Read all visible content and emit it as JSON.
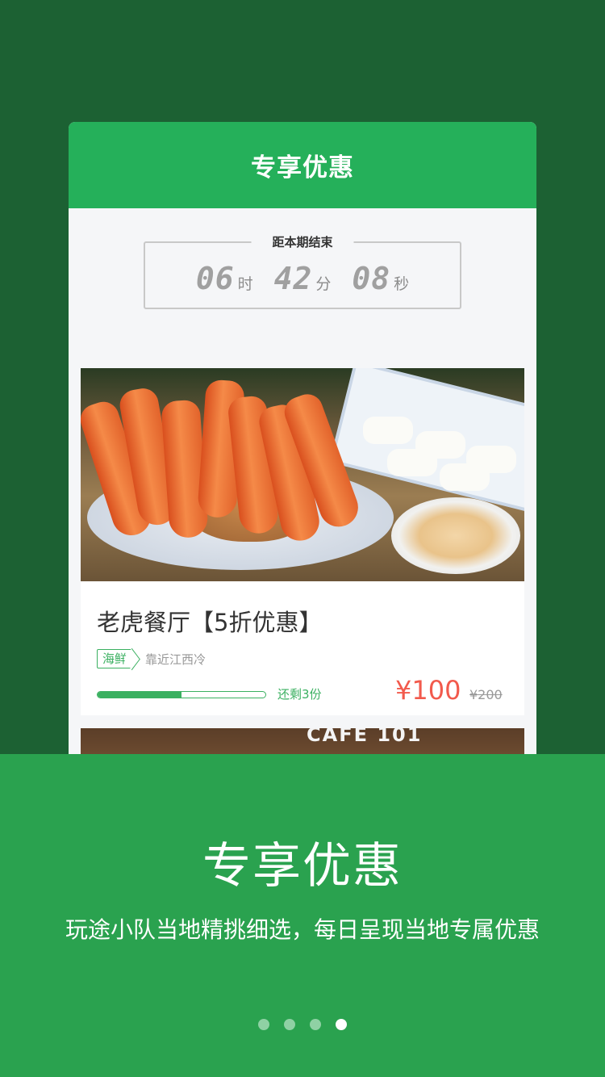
{
  "card": {
    "header_title": "专享优惠",
    "countdown": {
      "label": "距本期结束",
      "hours": "06",
      "hours_unit": "时",
      "minutes": "42",
      "minutes_unit": "分",
      "seconds": "08",
      "seconds_unit": "秒"
    },
    "deal": {
      "title": "老虎餐厅【5折优惠】",
      "tag": "海鲜",
      "location": "靠近江西冷",
      "progress_fraction": 0.5,
      "remaining": "还剩3份",
      "price": "¥100",
      "original_price": "¥200"
    },
    "next_deal": {
      "sign_text": "CAFE 101"
    }
  },
  "panel": {
    "title": "专享优惠",
    "subtitle": "玩途小队当地精挑细选，每日呈现当地专属优惠"
  },
  "pager": {
    "count": 4,
    "active_index": 3
  },
  "colors": {
    "background": "#1c6133",
    "header_green": "#25b05a",
    "panel_green": "#2aa24f",
    "accent_green": "#3ab060",
    "price_red": "#f25a4c"
  }
}
